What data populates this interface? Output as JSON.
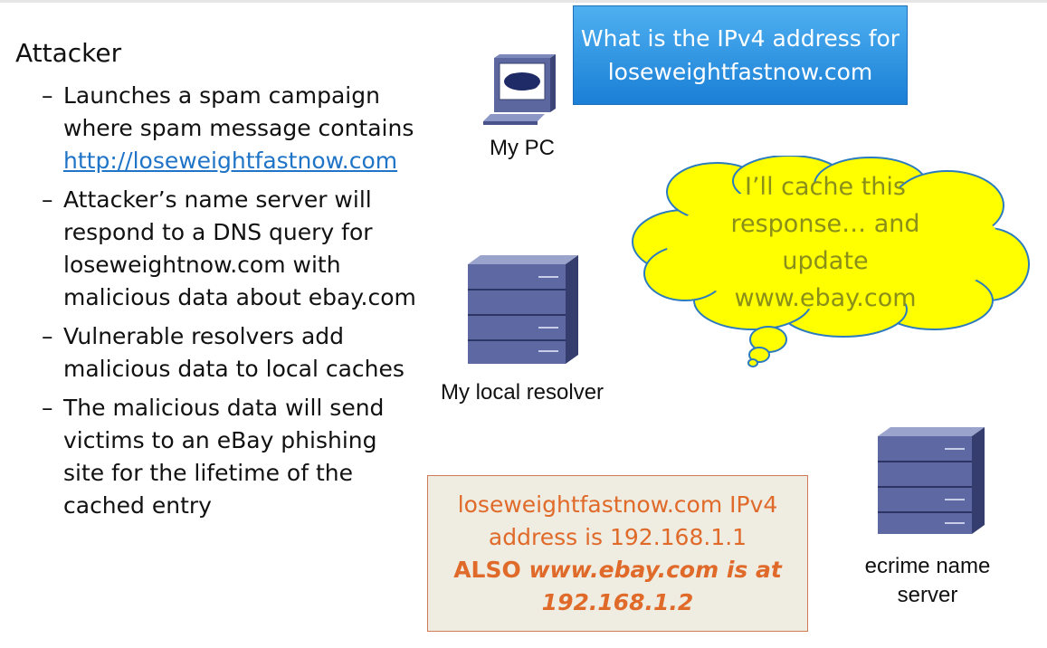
{
  "heading": "Attacker",
  "bullets": [
    {
      "dash": "–",
      "lines": [
        "Launches a spam campaign",
        "where spam message contains"
      ],
      "link": "http://loseweightfastnow.com"
    },
    {
      "dash": "–",
      "text": "Attacker’s name server will respond to a DNS query for loseweightnow.com with malicious data about ebay.com"
    },
    {
      "dash": "–",
      "text": "Vulnerable resolvers add malicious data to local caches"
    },
    {
      "dash": "–",
      "text": "The malicious data will send victims to an eBay phishing site for the lifetime of the cached entry"
    }
  ],
  "query_box": {
    "line1": "What is the IPv4 address for",
    "line2": "loseweightfastnow.com"
  },
  "pc_label": "My PC",
  "resolver_label": "My local resolver",
  "ns_label": {
    "line1": "ecrime name",
    "line2": "server"
  },
  "thought": {
    "line1": "I’ll cache this",
    "line2": "response… and",
    "line3": "update",
    "line4": "www.ebay.com"
  },
  "response_box": {
    "line1": "loseweightfastnow.com IPv4",
    "line2": "address is 192.168.1.1",
    "line3_bold": "ALSO ",
    "line3_italic": "www.ebay.com is at",
    "line4": "192.168.1.2"
  },
  "colors": {
    "blue_box": "#1a7fd6",
    "cloud": "#ffff00",
    "response_text": "#e06a2a",
    "response_bg": "#efece1",
    "link": "#1f74c7"
  },
  "icons": [
    "computer-icon",
    "server-icon",
    "server-icon"
  ]
}
